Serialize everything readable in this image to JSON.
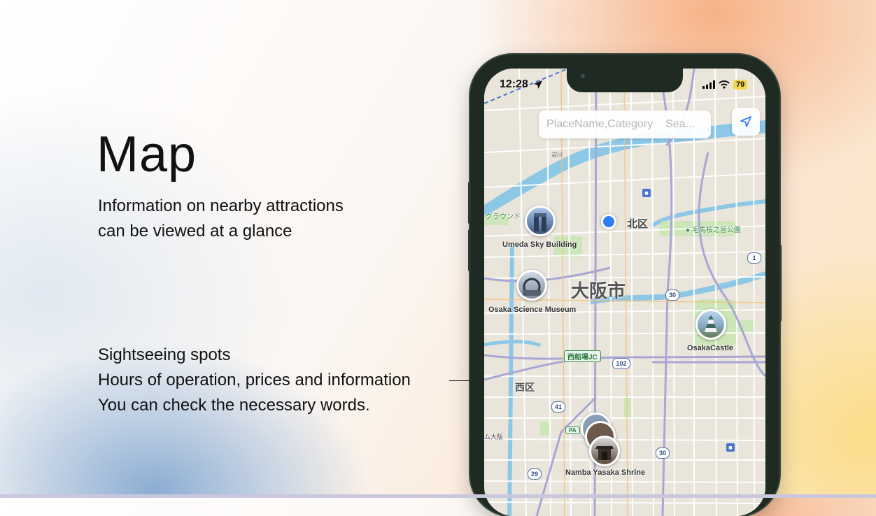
{
  "hero": {
    "title": "Map",
    "subtitle_lines": [
      "Information on nearby attractions",
      "can be viewed at a glance"
    ],
    "description_lines": [
      "Sightseeing spots",
      "Hours of operation, prices and information",
      "You can check the necessary words."
    ]
  },
  "phone": {
    "status_bar": {
      "time": "12:28",
      "battery": "79"
    },
    "search": {
      "placeholder": "PlaceName,Category",
      "button_label": "Sea..."
    },
    "map": {
      "district_labels": {
        "kita": "北区",
        "osaka_city": "大阪市",
        "nishi": "西区"
      },
      "place_labels": {
        "ground": "グラウンド",
        "park": "毛馬桜之宮公園",
        "junction": "西船場JC",
        "ps": "ム大阪",
        "pa": "PA",
        "river": "淀川"
      },
      "routes": [
        "1",
        "30",
        "102",
        "41",
        "29",
        "30"
      ],
      "pins": [
        {
          "label": "Umeda Sky Building"
        },
        {
          "label": "Osaka Science Museum"
        },
        {
          "label": "OsakaCastle"
        },
        {
          "label": "Namba Yasaka Shrine"
        }
      ]
    }
  },
  "colors": {
    "user_location": "#2f7cf6",
    "battery_bg": "#f3d64a",
    "river": "#8cc7e6",
    "park": "#cde6b8"
  }
}
